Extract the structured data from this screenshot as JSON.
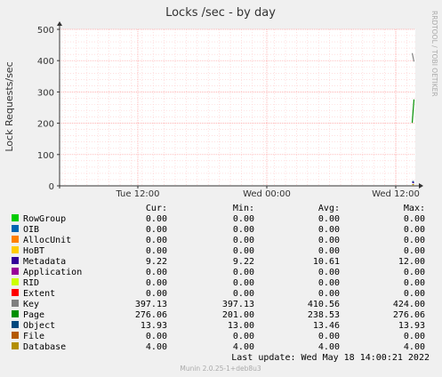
{
  "chart_data": {
    "type": "line",
    "title": "Locks /sec - by day",
    "ylabel": "Lock Requests/sec",
    "xlabel": "",
    "side_label": "RRDTOOL / TOBI OETIKER",
    "ylim": [
      0,
      500
    ],
    "yticks": [
      0,
      100,
      200,
      300,
      400,
      500
    ],
    "x_tick_labels": [
      "Tue 12:00",
      "Wed 00:00",
      "Wed 12:00"
    ],
    "grid": true,
    "columns": [
      "Cur:",
      "Min:",
      "Avg:",
      "Max:"
    ],
    "series": [
      {
        "name": "RowGroup",
        "color": "#00cc00",
        "cur": "0.00",
        "min": "0.00",
        "avg": "0.00",
        "max": "0.00"
      },
      {
        "name": "OIB",
        "color": "#0066b3",
        "cur": "0.00",
        "min": "0.00",
        "avg": "0.00",
        "max": "0.00"
      },
      {
        "name": "AllocUnit",
        "color": "#ff8000",
        "cur": "0.00",
        "min": "0.00",
        "avg": "0.00",
        "max": "0.00"
      },
      {
        "name": "HoBT",
        "color": "#ffcc00",
        "cur": "0.00",
        "min": "0.00",
        "avg": "0.00",
        "max": "0.00"
      },
      {
        "name": "Metadata",
        "color": "#330099",
        "cur": "9.22",
        "min": "9.22",
        "avg": "10.61",
        "max": "12.00"
      },
      {
        "name": "Application",
        "color": "#990099",
        "cur": "0.00",
        "min": "0.00",
        "avg": "0.00",
        "max": "0.00"
      },
      {
        "name": "RID",
        "color": "#ccff00",
        "cur": "0.00",
        "min": "0.00",
        "avg": "0.00",
        "max": "0.00"
      },
      {
        "name": "Extent",
        "color": "#ff0000",
        "cur": "0.00",
        "min": "0.00",
        "avg": "0.00",
        "max": "0.00"
      },
      {
        "name": "Key",
        "color": "#808080",
        "cur": "397.13",
        "min": "397.13",
        "avg": "410.56",
        "max": "424.00"
      },
      {
        "name": "Page",
        "color": "#008f00",
        "cur": "276.06",
        "min": "201.00",
        "avg": "238.53",
        "max": "276.06"
      },
      {
        "name": "Object",
        "color": "#00487d",
        "cur": "13.93",
        "min": "13.00",
        "avg": "13.46",
        "max": "13.93"
      },
      {
        "name": "File",
        "color": "#b35a00",
        "cur": "0.00",
        "min": "0.00",
        "avg": "0.00",
        "max": "0.00"
      },
      {
        "name": "Database",
        "color": "#b38f00",
        "cur": "4.00",
        "min": "4.00",
        "avg": "4.00",
        "max": "4.00"
      }
    ],
    "plotted_segments": [
      {
        "series": "Key",
        "from": 424.0,
        "to": 397.13
      },
      {
        "series": "Page",
        "from": 201.0,
        "to": 276.06
      },
      {
        "series": "Object",
        "from": 13.0,
        "to": 13.93
      },
      {
        "series": "Metadata",
        "from": 12.0,
        "to": 9.22
      },
      {
        "series": "Database",
        "from": 4.0,
        "to": 4.0
      }
    ]
  },
  "footer": {
    "last_update": "Last update: Wed May 18 14:00:21 2022",
    "version": "Munin 2.0.25-1+deb8u3"
  }
}
